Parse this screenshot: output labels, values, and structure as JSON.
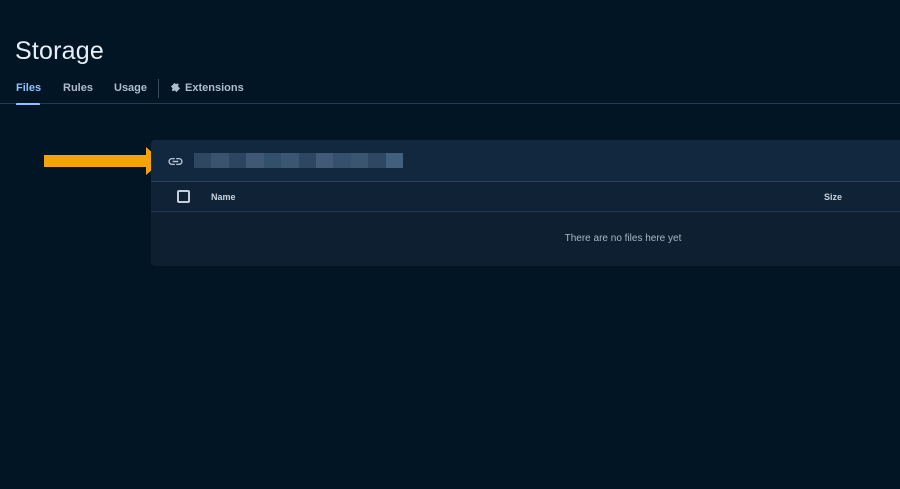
{
  "page": {
    "title": "Storage"
  },
  "tabs": [
    {
      "label": "Files",
      "active": true
    },
    {
      "label": "Rules",
      "active": false
    },
    {
      "label": "Usage",
      "active": false
    },
    {
      "label": "Extensions",
      "active": false,
      "icon": "extensions-icon"
    }
  ],
  "card": {
    "link_icon": "link-icon",
    "bucket_path": "",
    "table": {
      "columns": [
        "Name",
        "Size"
      ],
      "empty_message": "There are no files here yet"
    }
  },
  "annotation": {
    "arrow_color": "#f5a30a",
    "points_to": "link-icon"
  },
  "colors": {
    "background": "#021524",
    "accent": "#8fc2ff"
  }
}
